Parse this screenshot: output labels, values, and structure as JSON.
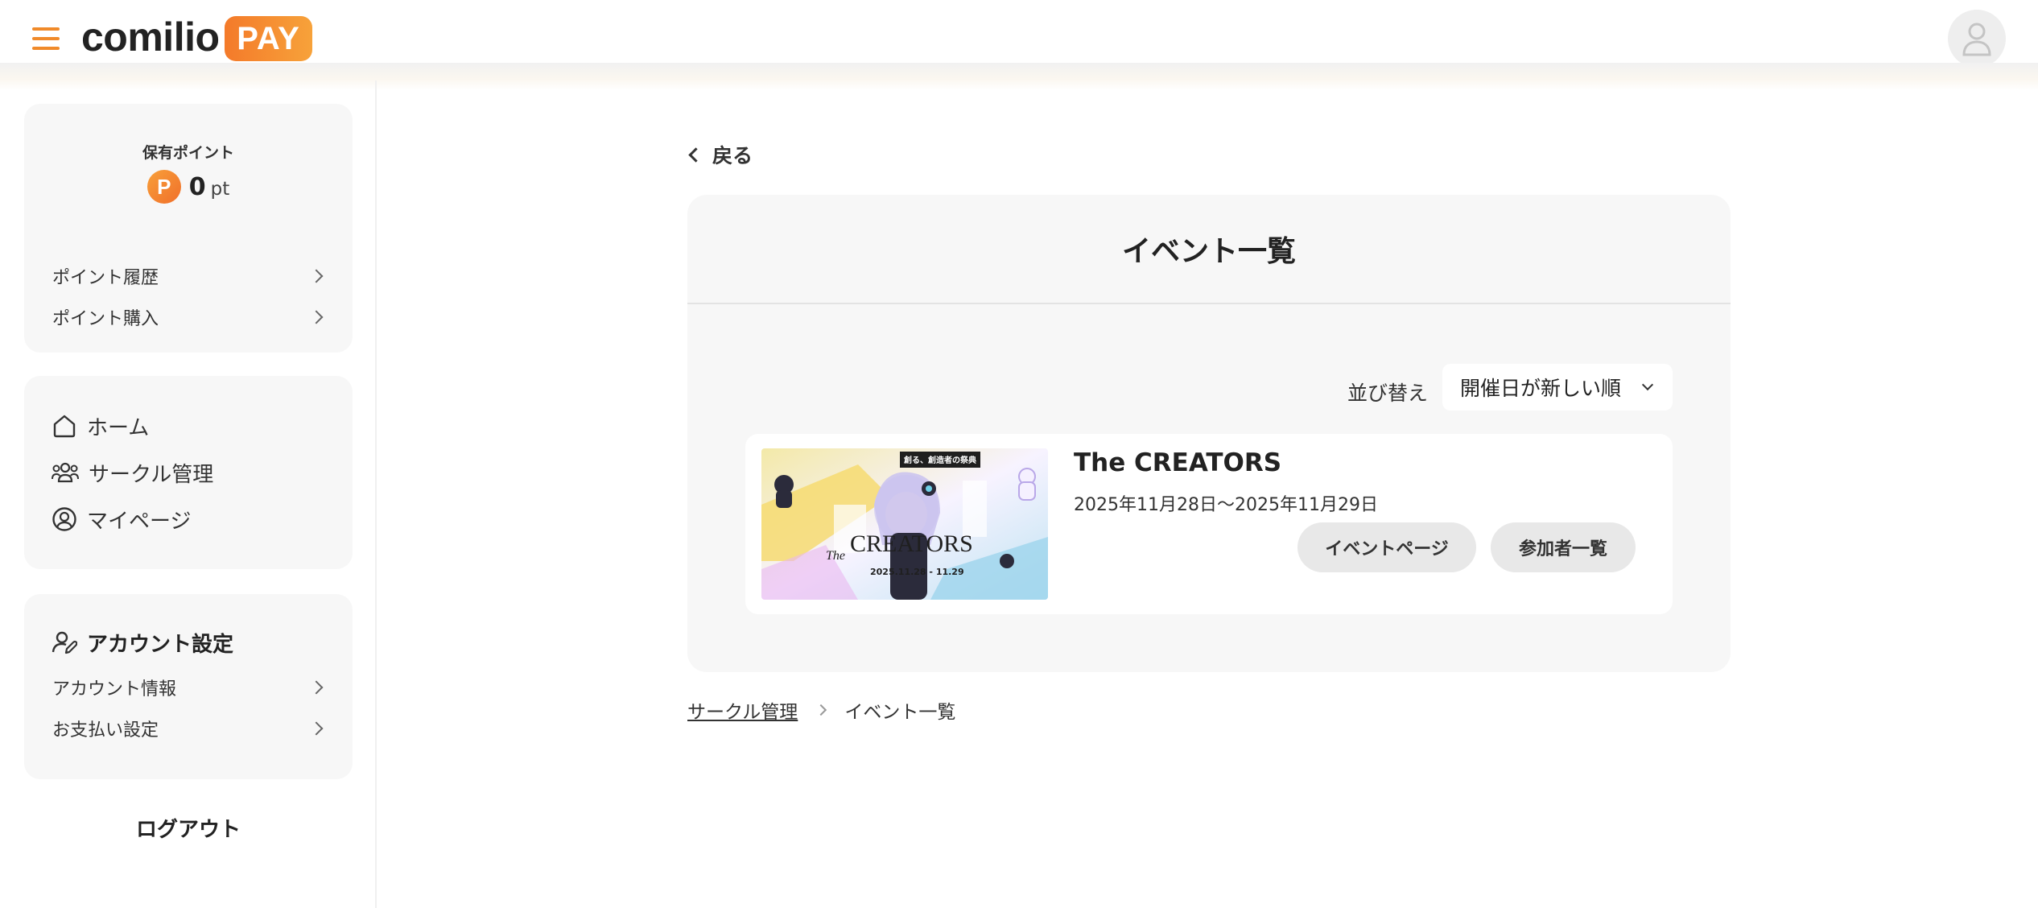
{
  "header": {
    "logo_text": "comilio",
    "logo_badge": "PAY"
  },
  "sidebar": {
    "points": {
      "label": "保有ポイント",
      "icon_letter": "P",
      "value": "0",
      "unit": "pt",
      "links": [
        {
          "label": "ポイント履歴"
        },
        {
          "label": "ポイント購入"
        }
      ]
    },
    "nav": [
      {
        "label": "ホーム",
        "icon": "home-icon"
      },
      {
        "label": "サークル管理",
        "icon": "users-icon"
      },
      {
        "label": "マイページ",
        "icon": "user-circle-icon"
      }
    ],
    "account": {
      "title": "アカウント設定",
      "links": [
        {
          "label": "アカウント情報"
        },
        {
          "label": "お支払い設定"
        }
      ]
    },
    "logout": "ログアウト"
  },
  "main": {
    "back_label": "戻る",
    "title": "イベント一覧",
    "sort": {
      "label": "並び替え",
      "selected": "開催日が新しい順"
    },
    "events": [
      {
        "title": "The CREATORS",
        "date": "2025年11月28日〜2025年11月29日",
        "buttons": [
          "イベントページ",
          "参加者一覧"
        ],
        "thumb_banner": "創る、創造者の祭典",
        "thumb_logo": "CREATORS",
        "thumb_logo_prefix": "The",
        "thumb_dates": "2025.11.28 - 11.29"
      }
    ],
    "breadcrumb": {
      "link": "サークル管理",
      "current": "イベント一覧"
    }
  },
  "colors": {
    "accent": "#f08a2a",
    "card_bg": "#f7f7f7",
    "button_bg": "#e8e8e8"
  }
}
